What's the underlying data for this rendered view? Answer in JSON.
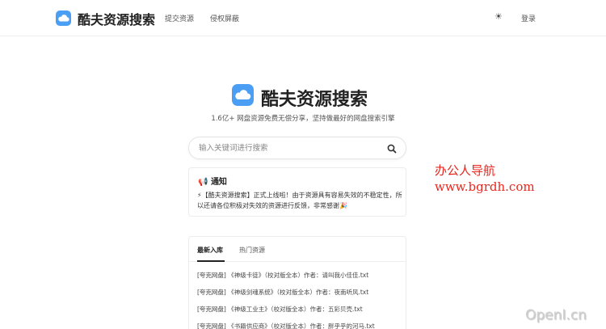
{
  "header": {
    "brand": "酷夫资源搜索",
    "nav": [
      "提交资源",
      "侵权屏蔽"
    ],
    "theme_icon": "☀",
    "login": "登录"
  },
  "hero": {
    "title": "酷夫资源搜索",
    "subtitle": "1.6亿+ 网盘资源免费无偿分享，坚持做最好的网盘搜索引擎"
  },
  "search": {
    "placeholder": "输入关键词进行搜索",
    "value": ""
  },
  "notice": {
    "icon": "📢",
    "title": "通知",
    "lead_icon": "⚡",
    "body": "【酷夫资源搜索】正式上线啦！由于资源具有容易失效的不稳定性，所以还请各位积极对失效的资源进行反馈，非常感谢",
    "tail_icon": "🎉"
  },
  "tabs": {
    "items": [
      "最新入库",
      "热门资源"
    ],
    "active": 0
  },
  "list": [
    "[夸克网盘] 《神级卡徒》（校对版全本）作者：请叫我小佳佳.txt",
    "[夸克网盘] 《神级剑魂系统》（校对版全本）作者：夜南听风.txt",
    "[夸克网盘] 《神级工业主》（校对版全本）作者：五彩贝壳.txt",
    "[夸克网盘] 《书籍供应商》（校对版全本）作者：胖乎乎的河马.txt"
  ],
  "watermarks": {
    "site_name": "办公人导航",
    "site_url": "www.bgrdh.com",
    "corner": "OpenI.cn"
  },
  "colors": {
    "accent": "#4a9ff5",
    "watermark_red": "#e8261e"
  }
}
